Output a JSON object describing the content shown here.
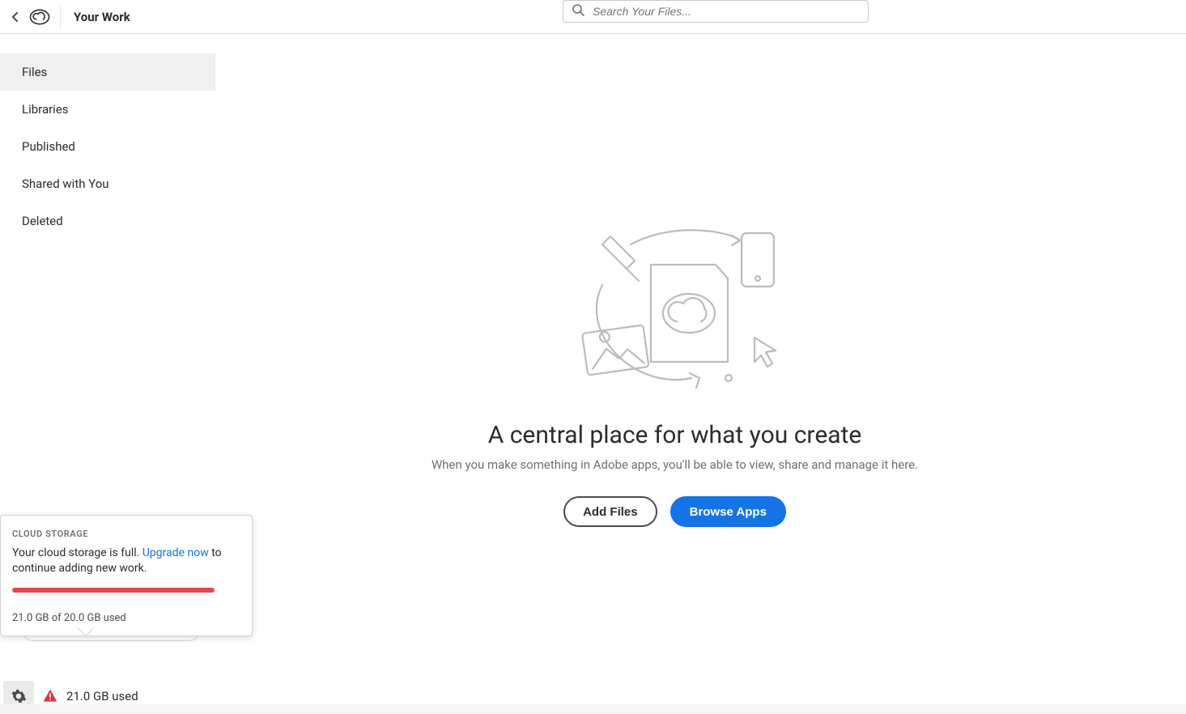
{
  "header": {
    "title": "Your Work",
    "search_placeholder": "Search Your Files..."
  },
  "sidebar": {
    "items": [
      {
        "label": "Files",
        "active": true
      },
      {
        "label": "Libraries",
        "active": false
      },
      {
        "label": "Published",
        "active": false
      },
      {
        "label": "Shared with You",
        "active": false
      },
      {
        "label": "Deleted",
        "active": false
      }
    ]
  },
  "hero": {
    "title": "A central place for what you create",
    "subtitle": "When you make something in Adobe apps, you'll be able to view, share and manage it here.",
    "add_button": "Add Files",
    "browse_button": "Browse Apps"
  },
  "storage_popover": {
    "heading": "CLOUD STORAGE",
    "message_prefix": "Your cloud storage is full. ",
    "upgrade_link": "Upgrade now",
    "message_suffix": " to continue adding new work.",
    "progress_percent": 100,
    "progress_color": "#e34850",
    "usage_line": "21.0 GB of 20.0 GB used"
  },
  "status_bar": {
    "used_label": "21.0 GB used"
  }
}
